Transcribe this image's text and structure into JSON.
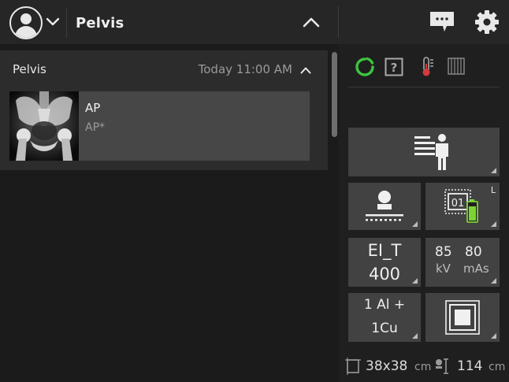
{
  "header": {
    "procedure_title": "Pelvis"
  },
  "procedure": {
    "name": "Pelvis",
    "time": "Today  11:00 AM",
    "view": {
      "name": "AP",
      "sublabel": "AP*"
    }
  },
  "acquisition": {
    "laterality_marker": "L",
    "cassette_number": "01",
    "exposure_index_label": "EI_T",
    "exposure_index_value": "400",
    "kv_value": "85",
    "kv_unit": "kV",
    "mas_value": "80",
    "mas_unit": "mAs",
    "filter_line1": "1 Al +",
    "filter_line2": "1Cu"
  },
  "footer": {
    "field_size": "38x38",
    "field_size_unit": "cm",
    "sid_value": "114",
    "sid_unit": "cm"
  },
  "colors": {
    "accent_green": "#3cc63c",
    "battery_green": "#7cd432",
    "background": "#1b1b1b",
    "tile": "#424242"
  }
}
